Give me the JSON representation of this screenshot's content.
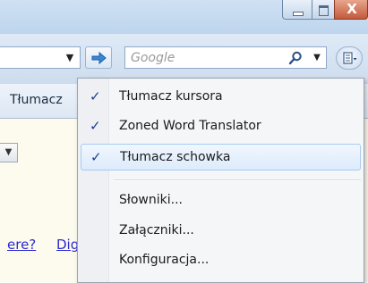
{
  "window": {
    "close_glyph": "X"
  },
  "toolbar": {
    "address_dropdown_glyph": "▼",
    "search": {
      "placeholder": "Google",
      "dropdown_glyph": "▼"
    },
    "icons": {
      "go": "right-arrow-icon",
      "search": "magnifier-icon",
      "page_menu": "page-menu-icon"
    }
  },
  "tab": {
    "label": "Tłumacz"
  },
  "content": {
    "dropdown_glyph": "▼",
    "links": [
      "ere?",
      "Dig"
    ],
    "background": "#fdfbed",
    "link_color": "#2a2ad0"
  },
  "menu": {
    "check_glyph": "✓",
    "items": [
      {
        "label": "Tłumacz kursora",
        "checked": true
      },
      {
        "label": "Zoned Word Translator",
        "checked": true
      },
      {
        "label": "Tłumacz schowka",
        "checked": true,
        "highlighted": true
      },
      {
        "label": "Słowniki..."
      },
      {
        "label": "Załączniki..."
      },
      {
        "label": "Konfiguracja..."
      }
    ],
    "accent": "#1d3c8c"
  }
}
